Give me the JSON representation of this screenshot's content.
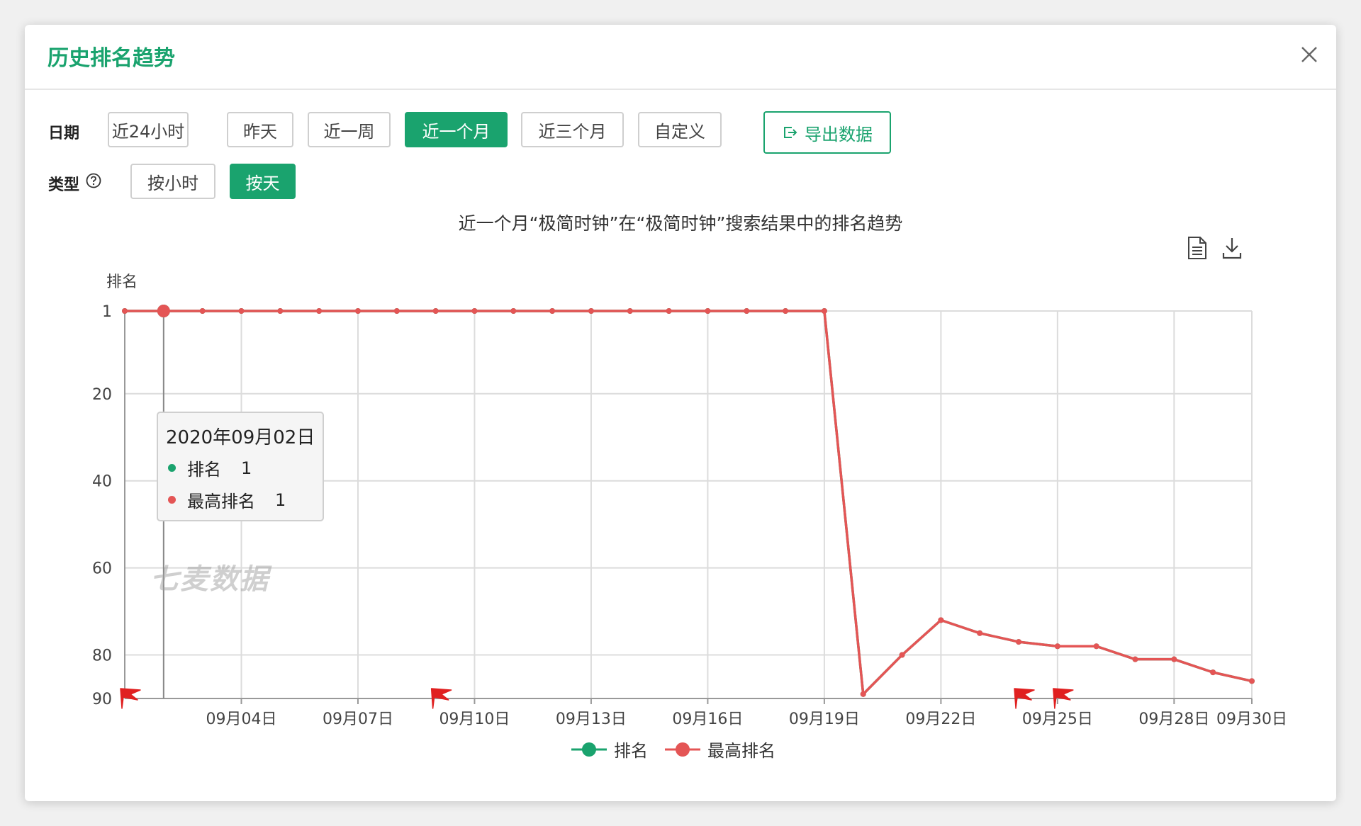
{
  "dialog": {
    "title": "历史排名趋势"
  },
  "filters": {
    "date_label": "日期",
    "date_options": [
      "近24小时",
      "昨天",
      "近一周",
      "近一个月",
      "近三个月",
      "自定义"
    ],
    "date_selected": "近一个月",
    "export_label": "导出数据",
    "type_label": "类型",
    "type_options": [
      "按小时",
      "按天"
    ],
    "type_selected": "按天"
  },
  "colors": {
    "accent": "#1aa36e",
    "series_max_rank": "#e45555",
    "series_rank": "#1aa36e"
  },
  "chart_data": {
    "type": "line",
    "title": "近一个月“极简时钟”在“极简时钟”搜索结果中的排名趋势",
    "ylabel": "排名",
    "y_inverted": true,
    "ylim": [
      1,
      90
    ],
    "y_ticks": [
      1,
      20,
      40,
      60,
      80,
      90
    ],
    "x": [
      "09月01日",
      "09月02日",
      "09月03日",
      "09月04日",
      "09月05日",
      "09月06日",
      "09月07日",
      "09月08日",
      "09月09日",
      "09月10日",
      "09月11日",
      "09月12日",
      "09月13日",
      "09月14日",
      "09月15日",
      "09月16日",
      "09月17日",
      "09月18日",
      "09月19日",
      "09月20日",
      "09月21日",
      "09月22日",
      "09月23日",
      "09月24日",
      "09月25日",
      "09月26日",
      "09月27日",
      "09月28日",
      "09月29日",
      "09月30日"
    ],
    "x_tick_labels": [
      "09月04日",
      "09月07日",
      "09月10日",
      "09月13日",
      "09月16日",
      "09月19日",
      "09月22日",
      "09月25日",
      "09月28日",
      "09月30日"
    ],
    "series": [
      {
        "name": "排名",
        "color": "#1aa36e",
        "values": [
          1,
          1,
          1,
          1,
          1,
          1,
          1,
          1,
          1,
          1,
          1,
          1,
          1,
          1,
          1,
          1,
          1,
          1,
          1,
          89,
          80,
          72,
          75,
          77,
          78,
          78,
          81,
          81,
          84,
          86
        ]
      },
      {
        "name": "最高排名",
        "color": "#e45555",
        "values": [
          1,
          1,
          1,
          1,
          1,
          1,
          1,
          1,
          1,
          1,
          1,
          1,
          1,
          1,
          1,
          1,
          1,
          1,
          1,
          89,
          80,
          72,
          75,
          77,
          78,
          78,
          81,
          81,
          84,
          86
        ]
      }
    ],
    "flags_at": [
      "09月01日",
      "09月09日",
      "09月24日",
      "09月25日"
    ],
    "grid": true,
    "legend_position": "bottom-center"
  },
  "tooltip": {
    "date": "2020年09月02日",
    "rows": [
      {
        "name": "排名",
        "value": "1",
        "color": "#1aa36e"
      },
      {
        "name": "最高排名",
        "value": "1",
        "color": "#e45555"
      }
    ]
  },
  "watermark": "七麦数据",
  "toolbox": [
    "data-view-icon",
    "download-icon"
  ]
}
